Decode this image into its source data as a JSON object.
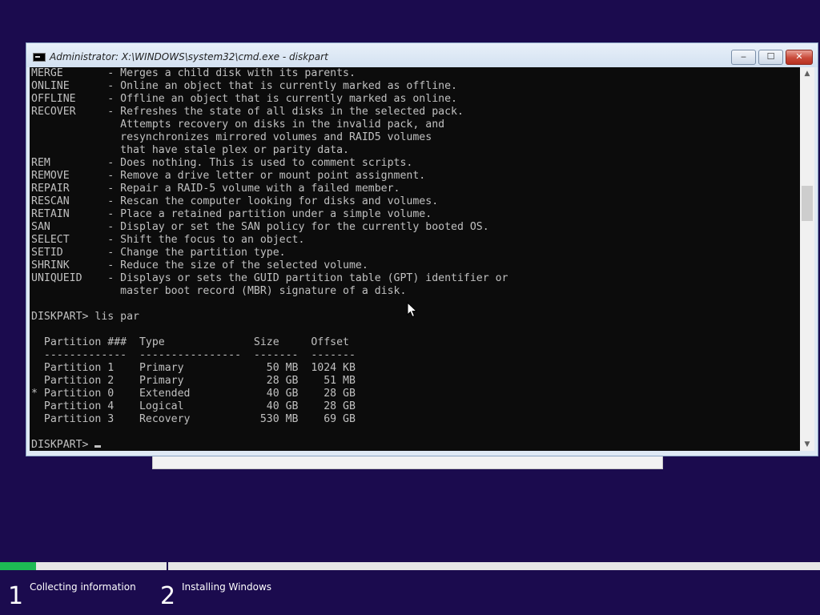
{
  "window": {
    "title": "Administrator: X:\\WINDOWS\\system32\\cmd.exe - diskpart",
    "min_label": "‒",
    "max_label": "☐",
    "close_label": "✕"
  },
  "console": {
    "lines": [
      "MERGE       - Merges a child disk with its parents.",
      "ONLINE      - Online an object that is currently marked as offline.",
      "OFFLINE     - Offline an object that is currently marked as online.",
      "RECOVER     - Refreshes the state of all disks in the selected pack.",
      "              Attempts recovery on disks in the invalid pack, and",
      "              resynchronizes mirrored volumes and RAID5 volumes",
      "              that have stale plex or parity data.",
      "REM         - Does nothing. This is used to comment scripts.",
      "REMOVE      - Remove a drive letter or mount point assignment.",
      "REPAIR      - Repair a RAID-5 volume with a failed member.",
      "RESCAN      - Rescan the computer looking for disks and volumes.",
      "RETAIN      - Place a retained partition under a simple volume.",
      "SAN         - Display or set the SAN policy for the currently booted OS.",
      "SELECT      - Shift the focus to an object.",
      "SETID       - Change the partition type.",
      "SHRINK      - Reduce the size of the selected volume.",
      "UNIQUEID    - Displays or sets the GUID partition table (GPT) identifier or",
      "              master boot record (MBR) signature of a disk.",
      "",
      "DISKPART> lis par",
      "",
      "  Partition ###  Type              Size     Offset",
      "  -------------  ----------------  -------  -------",
      "  Partition 1    Primary             50 MB  1024 KB",
      "  Partition 2    Primary             28 GB    51 MB",
      "* Partition 0    Extended            40 GB    28 GB",
      "  Partition 4    Logical             40 GB    28 GB",
      "  Partition 3    Recovery           530 MB    69 GB",
      ""
    ],
    "prompt": "DISKPART> "
  },
  "scrollbar": {
    "up_icon": "▲",
    "down_icon": "▼"
  },
  "setup_progress": {
    "fraction": 0.044,
    "steps": [
      {
        "number": "1",
        "label": "Collecting information"
      },
      {
        "number": "2",
        "label": "Installing Windows"
      }
    ]
  },
  "colors": {
    "background": "#1b0b4e",
    "progress": "#1db954",
    "console_text": "#c0c0c0"
  }
}
